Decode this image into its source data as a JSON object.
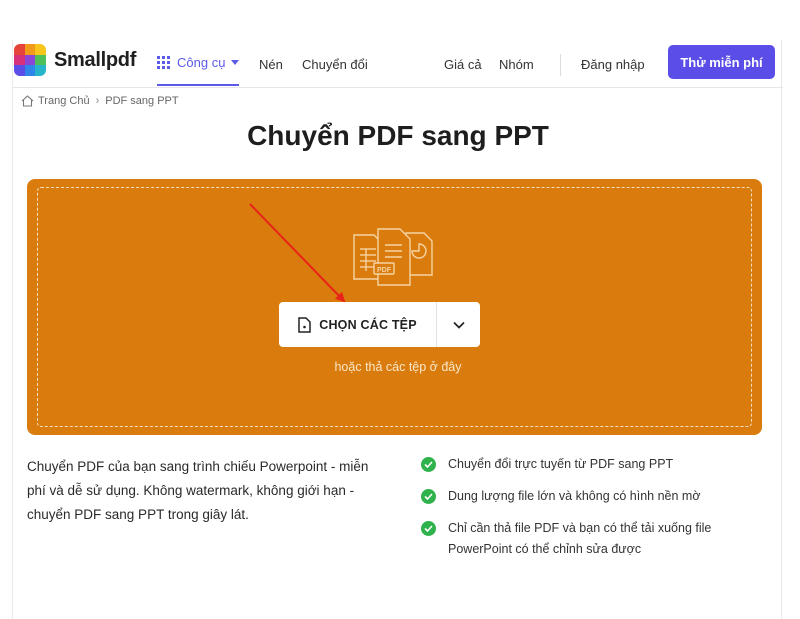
{
  "brand": {
    "name": "Smallpdf",
    "accent": "#5b4ee8",
    "primary_orange": "#d97c0d",
    "check_green": "#2fb24c"
  },
  "nav": {
    "tools_label": "Công cụ",
    "compress_label": "Nén",
    "convert_label": "Chuyển đổi",
    "pricing_label": "Giá cả",
    "team_label": "Nhóm",
    "login_label": "Đăng nhập",
    "trial_label": "Thử miễn phí"
  },
  "breadcrumb": {
    "home": "Trang Chủ",
    "current": "PDF sang PPT",
    "home_icon": "home-icon"
  },
  "page_title": "Chuyển PDF sang PPT",
  "dropzone": {
    "choose_label": "CHỌN CÁC TỆP",
    "hint": "hoặc thả các tệp ở đây",
    "illustration_badge": "PDF"
  },
  "description": "Chuyển PDF của bạn sang trình chiếu Powerpoint - miễn phí và dễ sử dụng. Không watermark, không giới hạn - chuyển PDF sang PPT trong giây lát.",
  "features": [
    "Chuyển đổi trực tuyến từ PDF sang PPT",
    "Dung lượng file lớn và không có hình nền mờ",
    "Chỉ cần thả file PDF và bạn có thể tải xuống file PowerPoint có thể chỉnh sửa được"
  ]
}
